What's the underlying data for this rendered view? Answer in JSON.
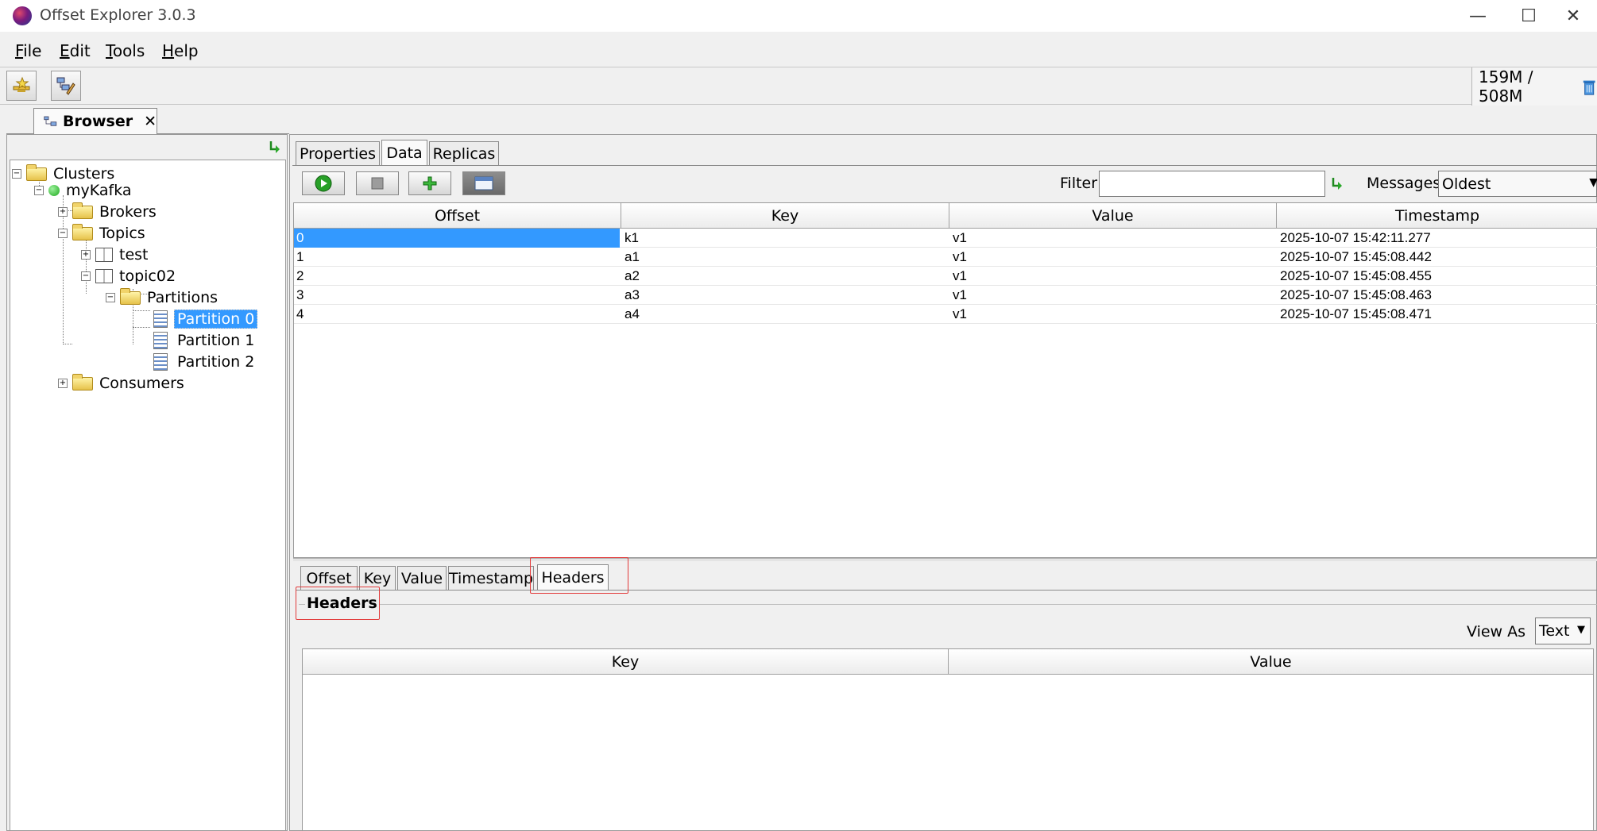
{
  "window": {
    "title": "Offset Explorer  3.0.3",
    "controls": {
      "minimize": "—",
      "maximize": "☐",
      "close": "✕"
    }
  },
  "menu": [
    {
      "label": "File",
      "mnemonic": "F",
      "rest": "ile"
    },
    {
      "label": "Edit",
      "mnemonic": "E",
      "rest": "dit"
    },
    {
      "label": "Tools",
      "mnemonic": "T",
      "rest": "ools"
    },
    {
      "label": "Help",
      "mnemonic": "H",
      "rest": "elp"
    }
  ],
  "toolbar": {
    "memory": "159M / 508M",
    "icons": [
      "connect-icon",
      "edit-connection-icon",
      "trash-icon"
    ]
  },
  "browser_tab": {
    "label": "Browser",
    "close": "✕"
  },
  "tree": {
    "clusters": "Clusters",
    "cluster": "myKafka",
    "brokers": "Brokers",
    "topics": "Topics",
    "topic_test": "test",
    "topic_02": "topic02",
    "partitions": "Partitions",
    "partition_0": "Partition 0",
    "partition_1": "Partition 1",
    "partition_2": "Partition 2",
    "consumers": "Consumers"
  },
  "top_tabs": {
    "properties": "Properties",
    "data": "Data",
    "replicas": "Replicas"
  },
  "data_toolbar": {
    "filter_label": "Filter",
    "filter_value": "",
    "messages_label": "Messages",
    "messages_value": "Oldest"
  },
  "messages_table": {
    "columns": [
      "Offset",
      "Key",
      "Value",
      "Timestamp"
    ],
    "rows": [
      {
        "offset": "0",
        "key": "k1",
        "value": "v1",
        "timestamp": "2025-10-07 15:42:11.277"
      },
      {
        "offset": "1",
        "key": "a1",
        "value": "v1",
        "timestamp": "2025-10-07 15:45:08.442"
      },
      {
        "offset": "2",
        "key": "a2",
        "value": "v1",
        "timestamp": "2025-10-07 15:45:08.455"
      },
      {
        "offset": "3",
        "key": "a3",
        "value": "v1",
        "timestamp": "2025-10-07 15:45:08.463"
      },
      {
        "offset": "4",
        "key": "a4",
        "value": "v1",
        "timestamp": "2025-10-07 15:45:08.471"
      }
    ]
  },
  "detail_tabs": {
    "offset": "Offset",
    "key": "Key",
    "value": "Value",
    "timestamp": "Timestamp",
    "headers": "Headers"
  },
  "headers_panel": {
    "group_title": "Headers",
    "view_as_label": "View As",
    "view_as_value": "Text",
    "columns": [
      "Key",
      "Value"
    ]
  },
  "colors": {
    "selection": "#3399ff",
    "highlight_box": "#e23b3b"
  }
}
